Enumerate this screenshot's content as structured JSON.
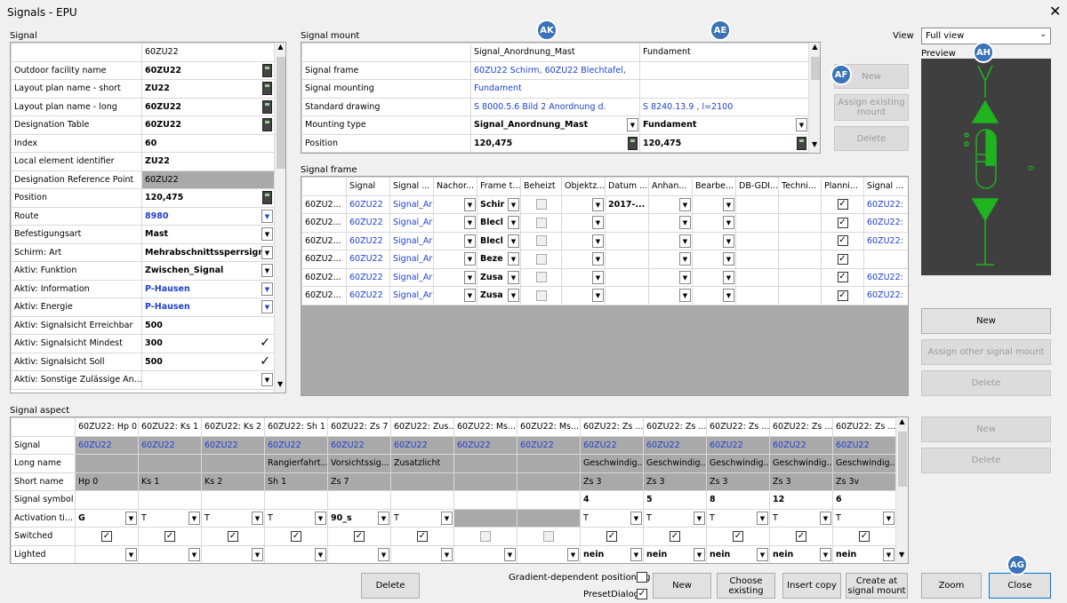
{
  "window": {
    "title": "Signals - EPU",
    "close": "✕"
  },
  "signal": {
    "section": "Signal",
    "column": "60ZU22",
    "rows": [
      {
        "label": "Outdoor facility name",
        "value": "60ZU22",
        "ctrl": "calc"
      },
      {
        "label": "Layout plan name - short",
        "value": "ZU22",
        "ctrl": "calc"
      },
      {
        "label": "Layout plan name - long",
        "value": "60ZU22",
        "ctrl": "calc"
      },
      {
        "label": "Designation Table",
        "value": "60ZU22",
        "ctrl": "calc"
      },
      {
        "label": "Index",
        "value": "60",
        "ctrl": ""
      },
      {
        "label": "Local element identifier",
        "value": "ZU22",
        "ctrl": ""
      },
      {
        "label": "Designation Reference Point",
        "value": "60ZU22",
        "ctrl": "gray"
      },
      {
        "label": "Position",
        "value": "120,475",
        "ctrl": "calc"
      },
      {
        "label": "Route",
        "value": "8980",
        "ctrl": "dd",
        "blue": true
      },
      {
        "label": "Befestigungsart",
        "value": "Mast",
        "ctrl": "dd"
      },
      {
        "label": "Schirm: Art",
        "value": "Mehrabschnittssperrsign",
        "ctrl": "dd"
      },
      {
        "label": "Aktiv: Funktion",
        "value": "Zwischen_Signal",
        "ctrl": "dd"
      },
      {
        "label": "Aktiv: Information",
        "value": "P-Hausen",
        "ctrl": "dd",
        "blue": true
      },
      {
        "label": "Aktiv: Energie",
        "value": "P-Hausen",
        "ctrl": "dd",
        "blue": true
      },
      {
        "label": "Aktiv: Signalsicht Erreichbar",
        "value": "500",
        "ctrl": ""
      },
      {
        "label": "Aktiv: Signalsicht Mindest",
        "value": "300",
        "ctrl": "check"
      },
      {
        "label": "Aktiv: Signalsicht Soll",
        "value": "500",
        "ctrl": "check"
      },
      {
        "label": "Aktiv: Sonstige Zulässige An...",
        "value": "",
        "ctrl": "dd"
      }
    ]
  },
  "mount": {
    "section": "Signal mount",
    "columns": [
      "Signal_Anordnung_Mast",
      "Fundament"
    ],
    "rows": [
      {
        "label": "Signal frame",
        "v1": "60ZU22 Schirm, 60ZU22 Blechtafel,",
        "v2": "",
        "blue": true
      },
      {
        "label": "Signal mounting",
        "v1": "Fundament",
        "v2": "",
        "blue": true
      },
      {
        "label": "Standard drawing",
        "v1": "S 8000.5.6 Bild 2 Anordnung d.",
        "v2": "S 8240.13.9 , l=2100",
        "blue": true
      },
      {
        "label": "Mounting type",
        "v1": "Signal_Anordnung_Mast",
        "v2": "Fundament",
        "ctrl": "dd"
      },
      {
        "label": "Position",
        "v1": "120,475",
        "v2": "120,475",
        "ctrl": "calc"
      }
    ],
    "btn_new": "New",
    "btn_assign": "Assign existing mount",
    "btn_delete": "Delete"
  },
  "view": {
    "label": "View",
    "value": "Full view",
    "preview": "Preview"
  },
  "frame": {
    "section": "Signal frame",
    "headers": [
      "",
      "Signal",
      "Signal ...",
      "Nachor...",
      "Frame t...",
      "Beheizt",
      "Objektz...",
      "Datum ...",
      "Anhan...",
      "Bearbe...",
      "DB-GDI...",
      "Techni...",
      "Planni...",
      "Signal ..."
    ],
    "rows": [
      {
        "id": "60ZU2...",
        "sig": "60ZU22",
        "sig2": "Signal_Ar",
        "ft": "Schir",
        "datum": "2017-...",
        "sig3": "60ZU22:"
      },
      {
        "id": "60ZU2...",
        "sig": "60ZU22",
        "sig2": "Signal_Ar",
        "ft": "Blecl",
        "datum": "",
        "sig3": "60ZU22:"
      },
      {
        "id": "60ZU2...",
        "sig": "60ZU22",
        "sig2": "Signal_Ar",
        "ft": "Blecl",
        "datum": "",
        "sig3": "60ZU22:"
      },
      {
        "id": "60ZU2...",
        "sig": "60ZU22",
        "sig2": "Signal_Ar",
        "ft": "Beze",
        "datum": "",
        "sig3": ""
      },
      {
        "id": "60ZU2...",
        "sig": "60ZU22",
        "sig2": "Signal_Ar",
        "ft": "Zusa",
        "datum": "",
        "sig3": "60ZU22:"
      },
      {
        "id": "60ZU2...",
        "sig": "60ZU22",
        "sig2": "Signal_Ar",
        "ft": "Zusa",
        "datum": "",
        "sig3": "60ZU22:"
      }
    ],
    "btn_new": "New",
    "btn_assign": "Assign other signal mount",
    "btn_delete": "Delete"
  },
  "aspect": {
    "section": "Signal aspect",
    "columns": [
      "60ZU22: Hp 0",
      "60ZU22: Ks 1",
      "60ZU22: Ks 2",
      "60ZU22: Sh 1",
      "60ZU22: Zs 7",
      "60ZU22: Zus...",
      "60ZU22: Ms...",
      "60ZU22: Ms...",
      "60ZU22: Zs ...",
      "60ZU22: Zs ...",
      "60ZU22: Zs ...",
      "60ZU22: Zs ...",
      "60ZU22: Zs ..."
    ],
    "row_labels": [
      "Signal",
      "Long name",
      "Short name",
      "Signal symbol",
      "Activation ti...",
      "Switched",
      "Lighted"
    ],
    "signal": "60ZU22",
    "long": [
      "",
      "",
      "",
      "Rangierfahrt...",
      "Vorsichtssig...",
      "Zusatzlicht",
      "",
      "",
      "Geschwindig...",
      "Geschwindig...",
      "Geschwindig...",
      "Geschwindig...",
      "Geschwindig..."
    ],
    "short": [
      "Hp 0",
      "Ks 1",
      "Ks 2",
      "Sh 1",
      "Zs 7",
      "",
      "",
      "",
      "Zs 3",
      "Zs 3",
      "Zs 3",
      "Zs 3",
      "Zs 3v"
    ],
    "symbol": [
      "",
      "",
      "",
      "",
      "",
      "",
      "",
      "",
      "4",
      "5",
      "8",
      "12",
      "6"
    ],
    "activation": [
      "G",
      "T",
      "T",
      "T",
      "90_s",
      "T",
      "",
      "",
      "T",
      "T",
      "T",
      "T",
      "T"
    ],
    "lighted": [
      "",
      "",
      "",
      "",
      "",
      "",
      "",
      "",
      "nein",
      "nein",
      "nein",
      "nein",
      "nein"
    ],
    "btn_new": "New",
    "btn_delete": "Delete"
  },
  "bottom": {
    "delete": "Delete",
    "gradient": "Gradient-dependent positioning",
    "preset": "PresetDialog",
    "new": "New",
    "choose": "Choose existing",
    "insert": "Insert copy",
    "create": "Create at signal mount",
    "zoom": "Zoom",
    "close": "Close"
  },
  "badges": {
    "ak": "AK",
    "ae": "AE",
    "af": "AF",
    "ah": "AH",
    "ag": "AG"
  },
  "colors": {
    "preview_bg": "#3f3f3f",
    "signal_green": "#1fb31f",
    "link_blue": "#1f3fd1",
    "badge": "#3b72b8"
  }
}
